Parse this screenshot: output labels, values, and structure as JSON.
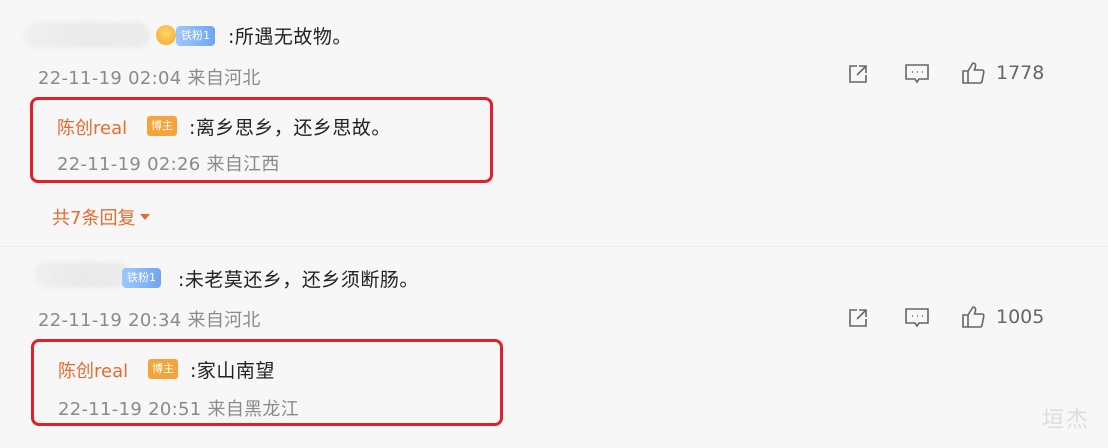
{
  "comments": [
    {
      "fan_badge": "铁粉1",
      "text": ":所遇无故物。",
      "timestamp": "22-11-19 02:04",
      "location": "来自河北",
      "likes": "1778",
      "reply": {
        "author": "陈创real",
        "badge": "博主",
        "text": ":离乡思乡，还乡思故。",
        "timestamp": "22-11-19 02:26",
        "location": "来自江西"
      },
      "more_replies": "共7条回复"
    },
    {
      "fan_badge": "铁粉1",
      "text": ":未老莫还乡，还乡须断肠。",
      "timestamp": "22-11-19 20:34",
      "location": "来自河北",
      "likes": "1005",
      "reply": {
        "author": "陈创real",
        "badge": "博主",
        "text": ":家山南望",
        "timestamp": "22-11-19 20:51",
        "location": "来自黑龙江"
      }
    }
  ],
  "watermark": "垣杰",
  "colors": {
    "highlight_border": "#e0202a",
    "author": "#e96a2e",
    "badge": "#f6a43a"
  }
}
